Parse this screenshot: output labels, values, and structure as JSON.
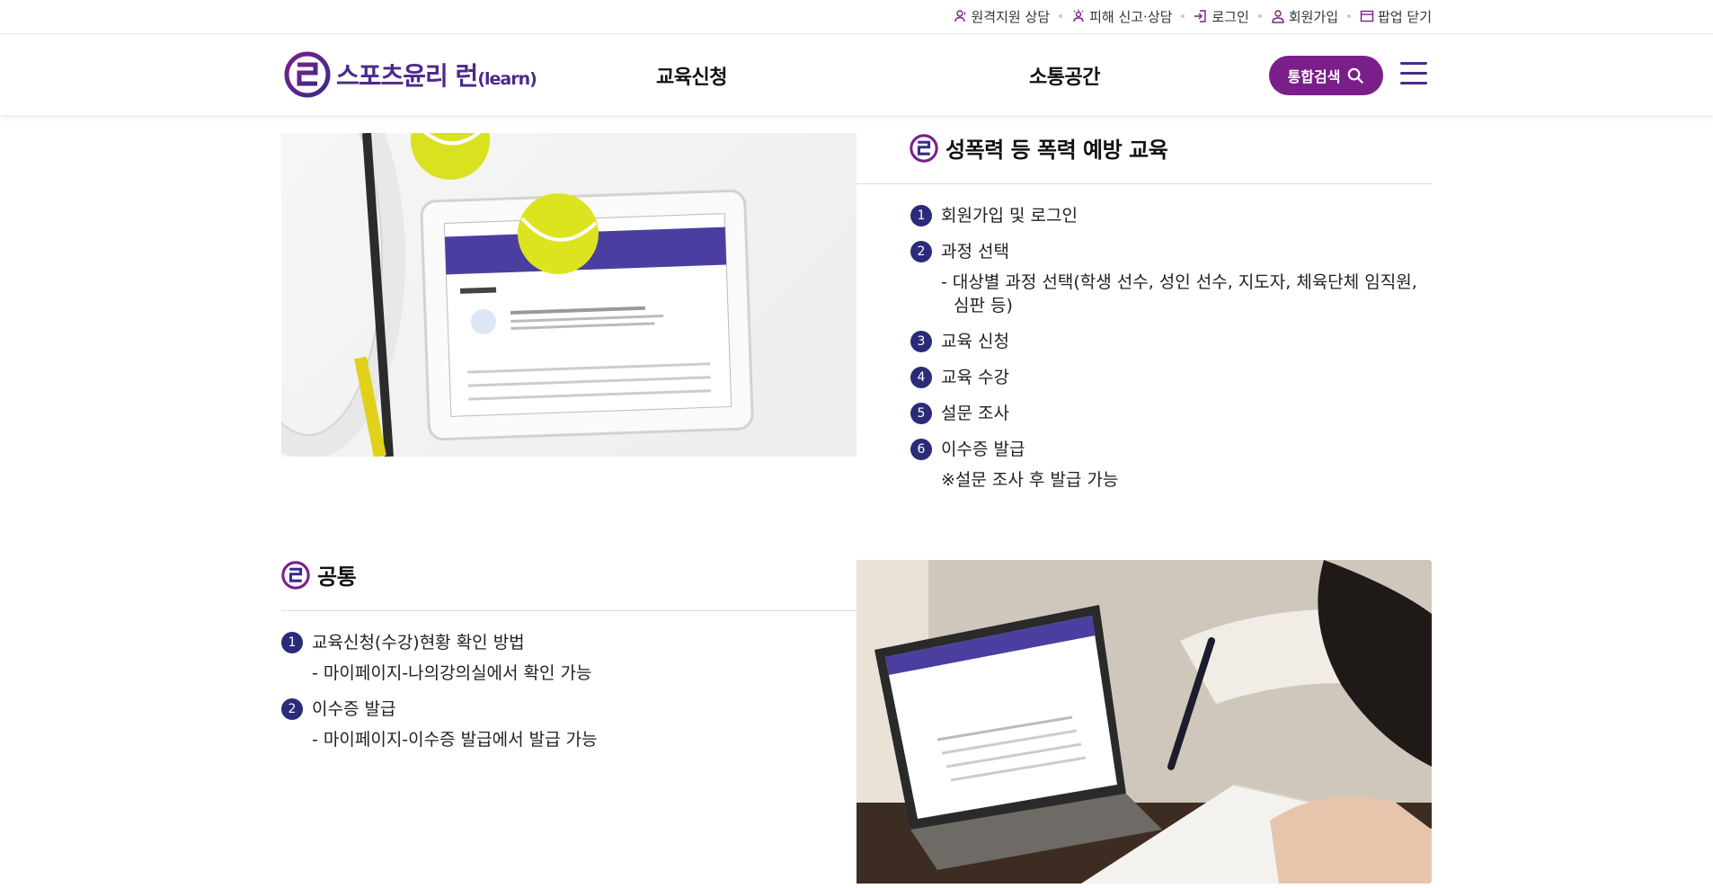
{
  "utility": {
    "remote": "원격지원 상담",
    "report": "피해 신고·상담",
    "login": "로그인",
    "signup": "회원가입",
    "close_popup": "팝업 닫기"
  },
  "header": {
    "logo_main": "스포츠윤리 런",
    "logo_sub": "(learn)",
    "nav": [
      "교육신청",
      "소통공간"
    ],
    "search_label": "통합검색"
  },
  "section1": {
    "title": "성폭력 등 폭력 예방 교육",
    "steps": [
      {
        "num": "1",
        "label": "회원가입 및 로그인"
      },
      {
        "num": "2",
        "label": "과정 선택",
        "sub": "- 대상별 과정 선택(학생 선수, 성인 선수, 지도자, 체육단체 임직원, 심판 등)"
      },
      {
        "num": "3",
        "label": "교육 신청"
      },
      {
        "num": "4",
        "label": "교육 수강"
      },
      {
        "num": "5",
        "label": "설문 조사"
      },
      {
        "num": "6",
        "label": "이수증 발급",
        "sub": "※설문 조사 후 발급 가능"
      }
    ]
  },
  "section2": {
    "title": "공통",
    "steps": [
      {
        "num": "1",
        "label": "교육신청(수강)현황 확인 방법",
        "sub": "- 마이페이지-나의강의실에서 확인 가능"
      },
      {
        "num": "2",
        "label": "이수증 발급",
        "sub": "- 마이페이지-이수증 발급에서 발급 가능"
      }
    ]
  },
  "colors": {
    "brand_purple": "#4a2a8c",
    "search_button": "#7a1f8a",
    "step_badge": "#2b2b7a"
  }
}
